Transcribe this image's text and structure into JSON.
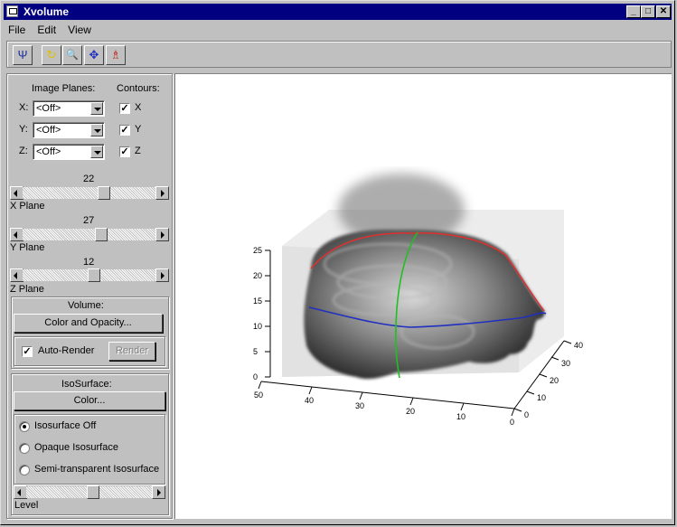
{
  "window": {
    "title": "Xvolume"
  },
  "title_buttons": {
    "minimize": "_",
    "maximize": "□",
    "close": "✕"
  },
  "menu": [
    "File",
    "Edit",
    "View"
  ],
  "toolbar": {
    "tools": [
      {
        "name": "rotate-tool-icon",
        "glyph": "Ψ"
      },
      {
        "name": "reset-tool-icon",
        "glyph": "↻"
      },
      {
        "name": "zoom-tool-icon",
        "glyph": "🔍"
      },
      {
        "name": "pan-tool-icon",
        "glyph": "✥"
      },
      {
        "name": "pick-tool-icon",
        "glyph": "♗"
      }
    ]
  },
  "panel": {
    "image_planes_label": "Image Planes:",
    "contours_label": "Contours:",
    "planes": [
      {
        "axis": "X:",
        "value": "<Off>",
        "contour": "X",
        "checked": true
      },
      {
        "axis": "Y:",
        "value": "<Off>",
        "contour": "Y",
        "checked": true
      },
      {
        "axis": "Z:",
        "value": "<Off>",
        "contour": "Z",
        "checked": true
      }
    ],
    "sliders": [
      {
        "value": "22",
        "label": "X Plane",
        "position": 0.62
      },
      {
        "value": "27",
        "label": "Y Plane",
        "position": 0.6
      },
      {
        "value": "12",
        "label": "Z Plane",
        "position": 0.54
      }
    ],
    "volume": {
      "heading": "Volume:",
      "color_opacity_button": "Color and Opacity...",
      "auto_render_label": "Auto-Render",
      "auto_render_checked": true,
      "render_button": "Render"
    },
    "isosurface": {
      "heading": "IsoSurface:",
      "color_button": "Color...",
      "options": [
        {
          "label": "Isosurface Off",
          "selected": true
        },
        {
          "label": "Opaque Isosurface",
          "selected": false
        },
        {
          "label": "Semi-transparent Isosurface",
          "selected": false
        }
      ],
      "level_label": "Level",
      "level_position": 0.53
    }
  },
  "render_view": {
    "x_tick_labels": [
      "50",
      "40",
      "30",
      "20",
      "10",
      "0"
    ],
    "y_tick_labels": [
      "0",
      "10",
      "20",
      "30",
      "40"
    ],
    "z_tick_labels": [
      "0",
      "5",
      "10",
      "15",
      "20",
      "25"
    ],
    "colors": {
      "x_contour": "#e03030",
      "y_contour": "#2030c0",
      "z_contour": "#20c020"
    }
  }
}
